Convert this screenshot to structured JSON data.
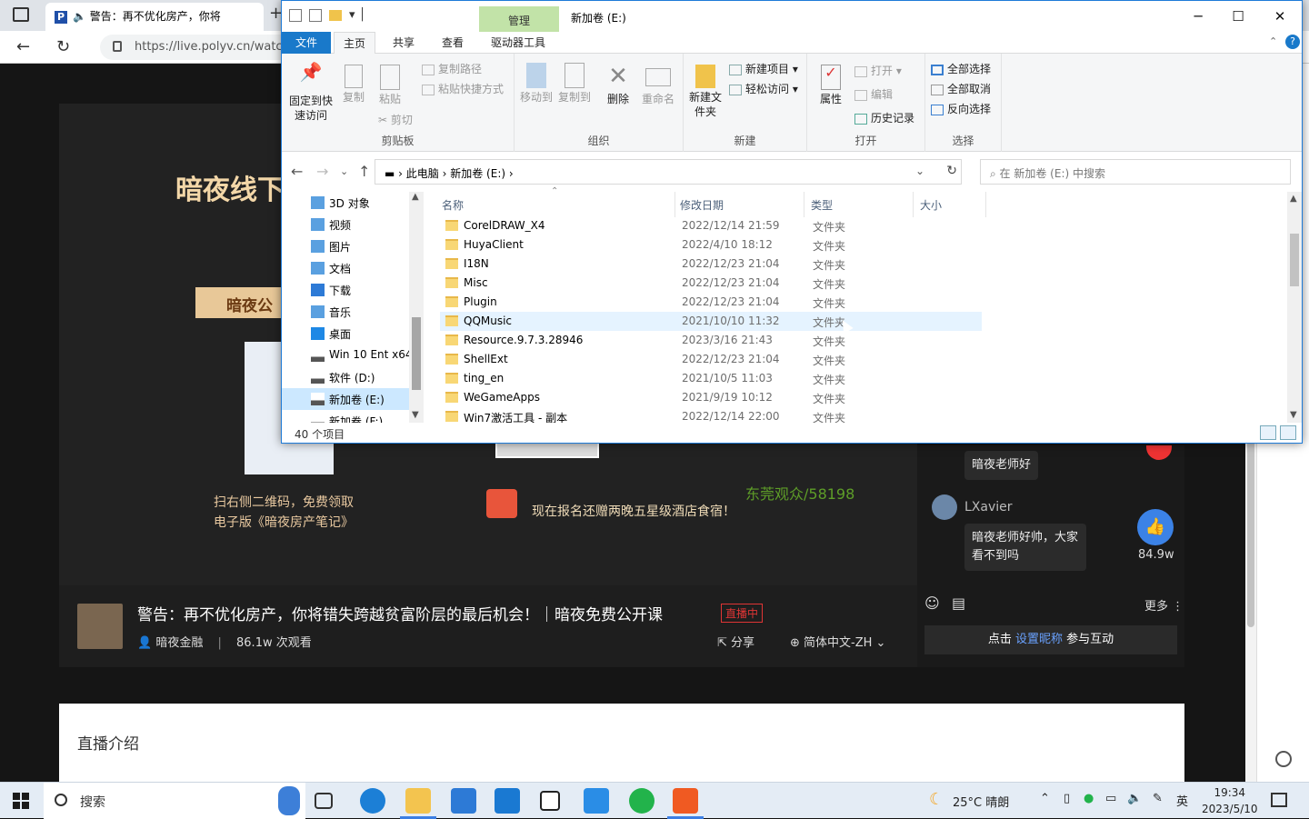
{
  "browser": {
    "tab_title": "警告：再不优化房产，你将",
    "tab_icon": "polyv-logo-icon",
    "url": "https://live.polyv.cn/watch"
  },
  "video": {
    "title": "暗夜线下",
    "badge": "暗夜公",
    "scan_text_1": "扫右侧二维码，免费领取",
    "scan_text_2": "电子版《暗夜房产笔记》",
    "hotel_text": "现在报名还赠两晚五星级酒店食宿！",
    "watermark": "东莞观众/58198"
  },
  "info": {
    "title": "警告：再不优化房产，你将错失跨越贫富阶层的最后机会！｜暗夜免费公开课",
    "live_badge": "直播中",
    "host": "暗夜金融",
    "views": "86.1w 次观看",
    "share": "分享",
    "language": "简体中文-ZH"
  },
  "chat": {
    "msg1": "暗夜老师好",
    "user2": "LXavier",
    "msg2": "暗夜老师好帅，大家看不到吗",
    "likes": "84.9w",
    "more": "更多",
    "input_prefix": "点击 ",
    "input_link": "设置昵称",
    "input_suffix": " 参与互动"
  },
  "intro": {
    "title": "直播介绍"
  },
  "explorer": {
    "context_tab": "管理",
    "window_title": "新加卷 (E:)",
    "tabs": {
      "file": "文件",
      "home": "主页",
      "share": "共享",
      "view": "查看",
      "drive_tools": "驱动器工具"
    },
    "ribbon": {
      "pin": "固定到快速访问",
      "copy": "复制",
      "paste": "粘贴",
      "copy_path": "复制路径",
      "paste_shortcut": "粘贴快捷方式",
      "cut": "剪切",
      "clipboard": "剪贴板",
      "move_to": "移动到",
      "copy_to": "复制到",
      "delete": "删除",
      "rename": "重命名",
      "organize": "组织",
      "new_folder": "新建文件夹",
      "new_item": "新建项目",
      "easy_access": "轻松访问",
      "new": "新建",
      "properties": "属性",
      "open": "打开",
      "edit": "编辑",
      "history": "历史记录",
      "open_group": "打开",
      "select_all": "全部选择",
      "select_none": "全部取消",
      "invert": "反向选择",
      "select": "选择"
    },
    "path": [
      "此电脑",
      "新加卷 (E:)"
    ],
    "search_placeholder": "在 新加卷 (E:) 中搜索",
    "nav_items": [
      {
        "label": "3D 对象",
        "icon": "3d-objects-icon"
      },
      {
        "label": "视频",
        "icon": "videos-icon"
      },
      {
        "label": "图片",
        "icon": "pictures-icon"
      },
      {
        "label": "文档",
        "icon": "documents-icon"
      },
      {
        "label": "下载",
        "icon": "downloads-icon"
      },
      {
        "label": "音乐",
        "icon": "music-icon"
      },
      {
        "label": "桌面",
        "icon": "desktop-icon"
      },
      {
        "label": "Win 10 Ent x64",
        "icon": "drive-icon"
      },
      {
        "label": "软件 (D:)",
        "icon": "drive-icon"
      },
      {
        "label": "新加卷 (E:)",
        "icon": "drive-icon"
      },
      {
        "label": "新加卷 (F:)",
        "icon": "drive-icon"
      }
    ],
    "columns": {
      "name": "名称",
      "date": "修改日期",
      "type": "类型",
      "size": "大小"
    },
    "files": [
      {
        "name": "CorelDRAW_X4",
        "date": "2022/12/14 21:59",
        "type": "文件夹"
      },
      {
        "name": "HuyaClient",
        "date": "2022/4/10 18:12",
        "type": "文件夹"
      },
      {
        "name": "I18N",
        "date": "2022/12/23 21:04",
        "type": "文件夹"
      },
      {
        "name": "Misc",
        "date": "2022/12/23 21:04",
        "type": "文件夹"
      },
      {
        "name": "Plugin",
        "date": "2022/12/23 21:04",
        "type": "文件夹"
      },
      {
        "name": "QQMusic",
        "date": "2021/10/10 11:32",
        "type": "文件夹"
      },
      {
        "name": "Resource.9.7.3.28946",
        "date": "2023/3/16 21:43",
        "type": "文件夹"
      },
      {
        "name": "ShellExt",
        "date": "2022/12/23 21:04",
        "type": "文件夹"
      },
      {
        "name": "ting_en",
        "date": "2021/10/5 11:03",
        "type": "文件夹"
      },
      {
        "name": "WeGameApps",
        "date": "2021/9/19 10:12",
        "type": "文件夹"
      },
      {
        "name": "Win7激活工具 - 副本",
        "date": "2022/12/14 22:00",
        "type": "文件夹"
      }
    ],
    "status": "40 个项目"
  },
  "taskbar": {
    "search": "搜索",
    "weather": "25°C  晴朗",
    "ime": "英",
    "time": "19:34",
    "date": "2023/5/10"
  }
}
